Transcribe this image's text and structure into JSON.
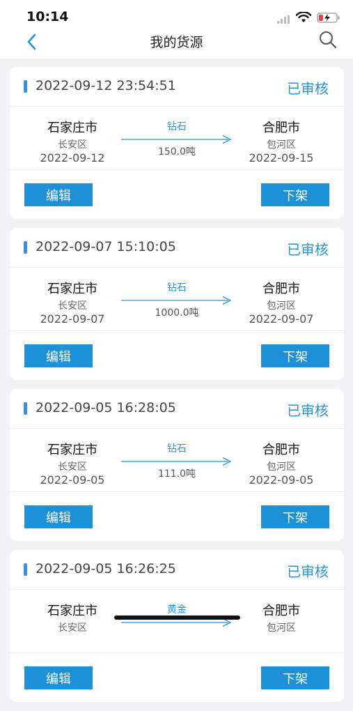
{
  "status_bar": {
    "time": "10:14",
    "icons": [
      "signal-icon",
      "wifi-icon",
      "battery-charging-icon"
    ],
    "battery_color": "#e24545"
  },
  "nav": {
    "title": "我的货源",
    "back_icon": "chevron-left-icon",
    "search_icon": "search-icon",
    "accent": "#2a94d8"
  },
  "cards": [
    {
      "time": "2022-09-12 23:54:51",
      "status": "已审核",
      "from": {
        "city": "石家庄市",
        "district": "长安区",
        "date": "2022-09-12"
      },
      "to": {
        "city": "合肥市",
        "district": "包河区",
        "date": "2022-09-15"
      },
      "cargo": "钻石",
      "weight": "150.0吨",
      "edit_label": "编辑",
      "off_label": "下架"
    },
    {
      "time": "2022-09-07 15:10:05",
      "status": "已审核",
      "from": {
        "city": "石家庄市",
        "district": "长安区",
        "date": "2022-09-07"
      },
      "to": {
        "city": "合肥市",
        "district": "包河区",
        "date": "2022-09-07"
      },
      "cargo": "钻石",
      "weight": "1000.0吨",
      "edit_label": "编辑",
      "off_label": "下架"
    },
    {
      "time": "2022-09-05 16:28:05",
      "status": "已审核",
      "from": {
        "city": "石家庄市",
        "district": "长安区",
        "date": "2022-09-05"
      },
      "to": {
        "city": "合肥市",
        "district": "包河区",
        "date": "2022-09-05"
      },
      "cargo": "钻石",
      "weight": "111.0吨",
      "edit_label": "编辑",
      "off_label": "下架"
    },
    {
      "time": "2022-09-05 16:26:25",
      "status": "已审核",
      "from": {
        "city": "石家庄市",
        "district": "长安区",
        "date": ""
      },
      "to": {
        "city": "合肥市",
        "district": "包河区",
        "date": ""
      },
      "cargo": "黄金",
      "weight": "",
      "edit_label": "编辑",
      "off_label": "下架"
    }
  ]
}
